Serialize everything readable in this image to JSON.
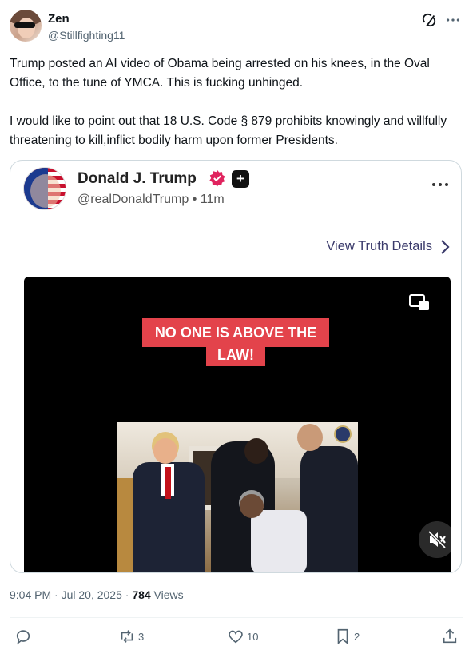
{
  "post": {
    "author_name": "Zen",
    "author_handle": "@Stillfighting11",
    "text": "Trump posted an AI video of Obama being arrested on his knees, in the Oval Office, to the tune of YMCA. This is fucking unhinged.\n\nI would like to point out that 18 U.S. Code § 879 prohibits knowingly and willfully threatening to kill,inflict bodily harm upon former Presidents.",
    "timestamp": "9:04 PM · Jul 20, 2025 · ",
    "views_count": "784",
    "views_label": " Views"
  },
  "embed": {
    "author_name": "Donald J. Trump",
    "author_handle": "@realDonaldTrump • 11m",
    "view_details_label": "View Truth Details",
    "caption_line1": "NO ONE IS ABOVE THE",
    "caption_line2": "LAW!"
  },
  "actions": {
    "reply_count": "",
    "repost_count": "3",
    "like_count": "10",
    "bookmark_count": "2"
  },
  "icons": {
    "grok": "grok-icon",
    "more": "more-icon",
    "verified": "verified-badge-icon",
    "plus": "plus-icon",
    "chevron": "chevron-right-icon",
    "pip": "picture-in-picture-icon",
    "mute": "muted-speaker-icon",
    "reply": "reply-icon",
    "repost": "repost-icon",
    "like": "heart-icon",
    "bookmark": "bookmark-icon",
    "share": "share-icon"
  },
  "colors": {
    "text_primary": "#0f1419",
    "text_secondary": "#536471",
    "border": "#cfd9de",
    "caption_bg": "#e3434b",
    "truth_link": "#3a3a6b"
  }
}
